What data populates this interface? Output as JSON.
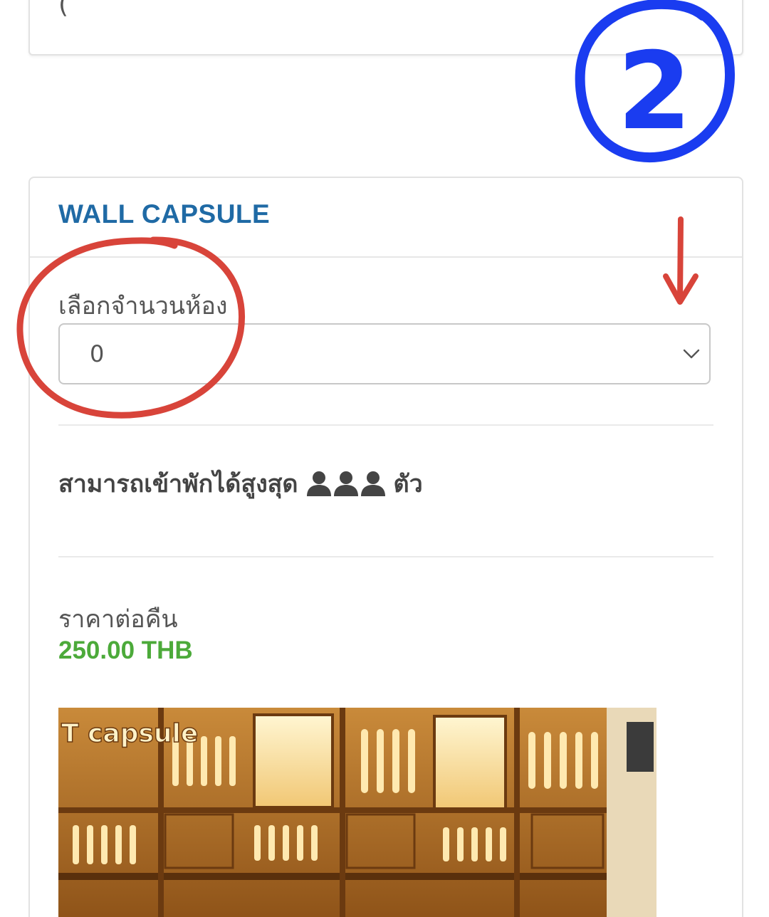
{
  "previous_card": {
    "clipped_text": "("
  },
  "room": {
    "title": "WALL CAPSULE",
    "select_label": "เลือกจำนวนห้อง",
    "select_value": "0",
    "capacity_text": "สามารถเข้าพักได้สูงสุด",
    "capacity_suffix": "ตัว",
    "capacity_count": 3,
    "price_label": "ราคาต่อคืน",
    "price_value": "250.00 THB",
    "photo_sign_text": "T capsule"
  },
  "annotations": {
    "step_number": "2",
    "step_color": "#1a3cf0",
    "circle_color": "#d8443a",
    "arrow_color": "#d8443a"
  },
  "colors": {
    "title": "#1f6aa5",
    "price": "#4caa3a"
  },
  "icons": {
    "dropdown": "chevron-down-icon",
    "capacity": "person-icon"
  }
}
